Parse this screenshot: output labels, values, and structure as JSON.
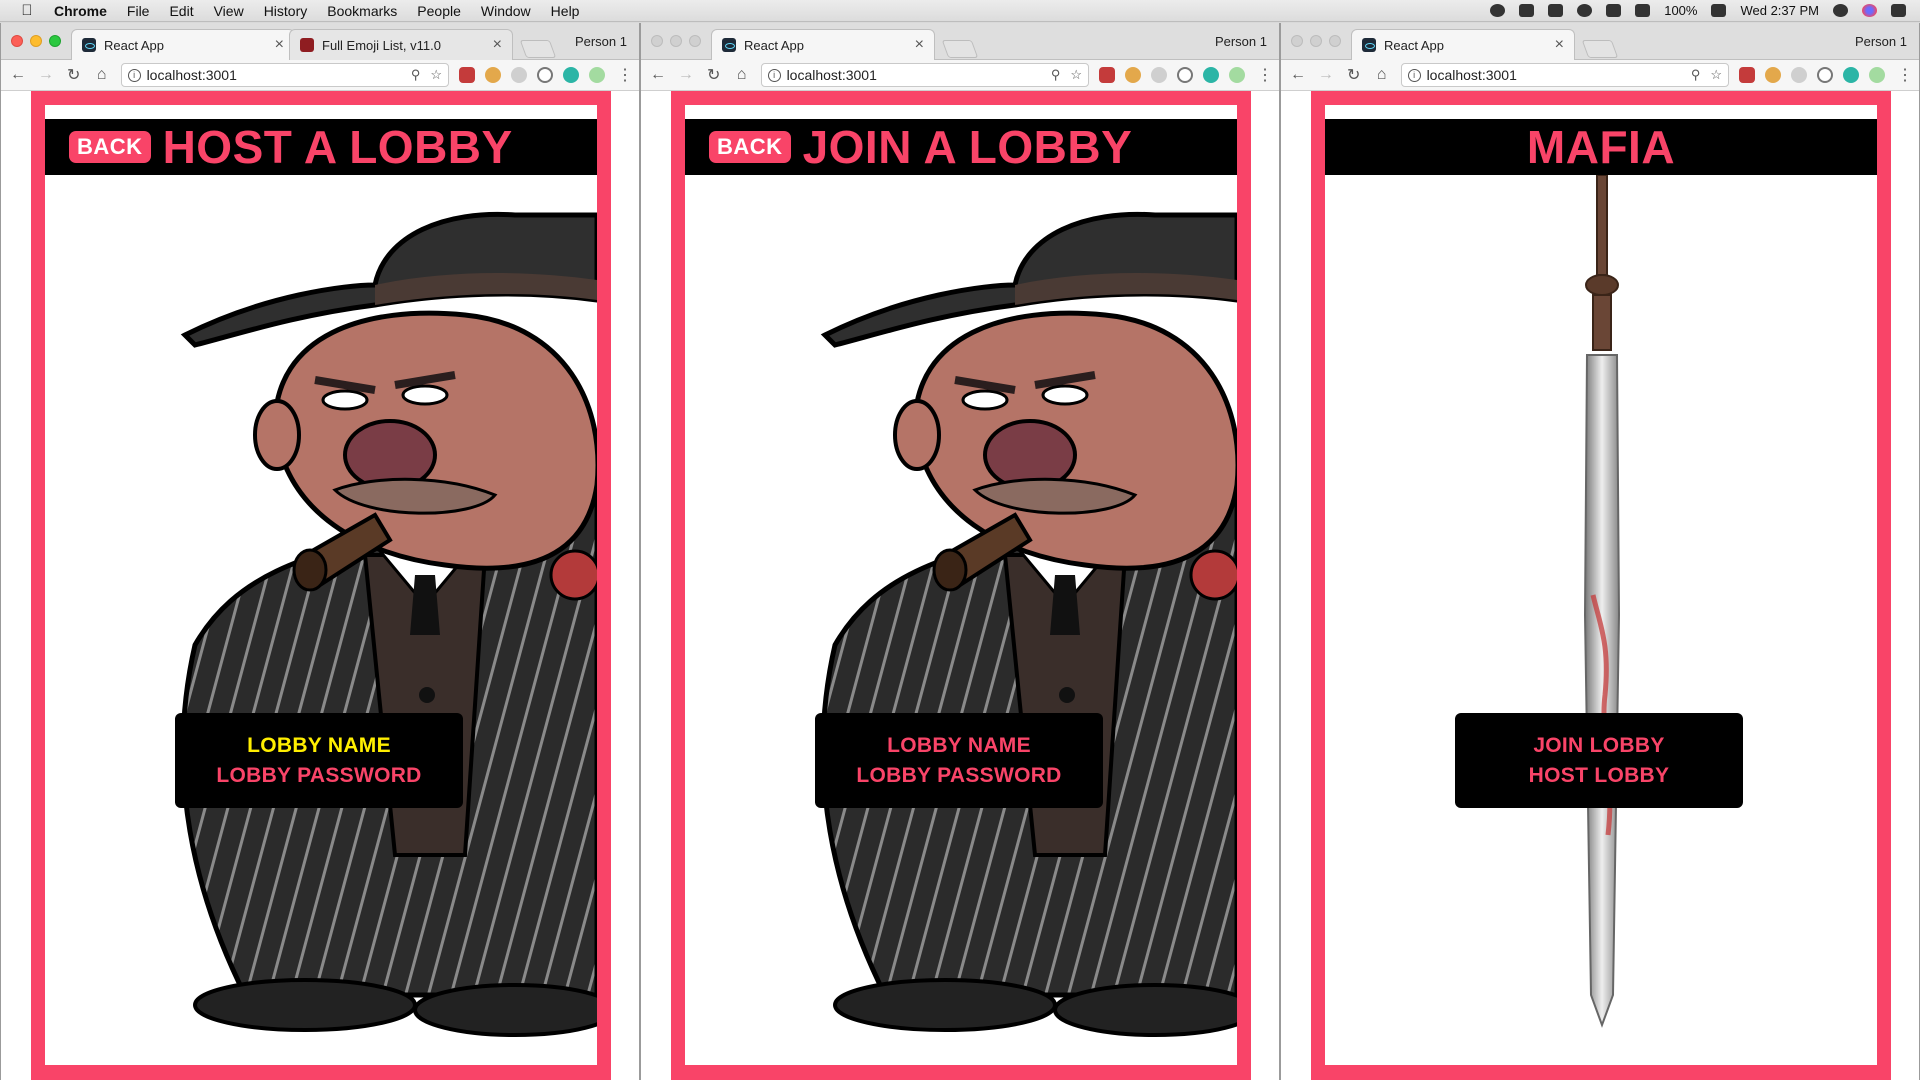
{
  "menubar": {
    "app": "Chrome",
    "items": [
      "File",
      "Edit",
      "View",
      "History",
      "Bookmarks",
      "People",
      "Window",
      "Help"
    ],
    "battery": "100%",
    "clock": "Wed 2:37 PM"
  },
  "windows": [
    {
      "tabs": [
        {
          "label": "React App",
          "favicon": "react-icon"
        },
        {
          "label": "Full Emoji List, v11.0",
          "favicon": "unicode-icon"
        }
      ],
      "person": "Person 1",
      "url": "localhost:3001",
      "header": {
        "back": "BACK",
        "title": "HOST A LOBBY"
      },
      "menu": [
        "LOBBY NAME",
        "LOBBY PASSWORD"
      ],
      "selected_index": 0
    },
    {
      "tabs": [
        {
          "label": "React App",
          "favicon": "react-icon"
        }
      ],
      "person": "Person 1",
      "url": "localhost:3001",
      "header": {
        "back": "BACK",
        "title": "JOIN A LOBBY"
      },
      "menu": [
        "LOBBY NAME",
        "LOBBY PASSWORD"
      ],
      "selected_index": -1
    },
    {
      "tabs": [
        {
          "label": "React App",
          "favicon": "react-icon"
        }
      ],
      "person": "Person 1",
      "url": "localhost:3001",
      "header": {
        "title": "MAFIA"
      },
      "menu": [
        "JOIN LOBBY",
        "HOST LOBBY"
      ],
      "selected_index": -1
    }
  ],
  "colors": {
    "accent": "#f94468",
    "selected": "#ffee00",
    "header_bg": "#000000"
  }
}
